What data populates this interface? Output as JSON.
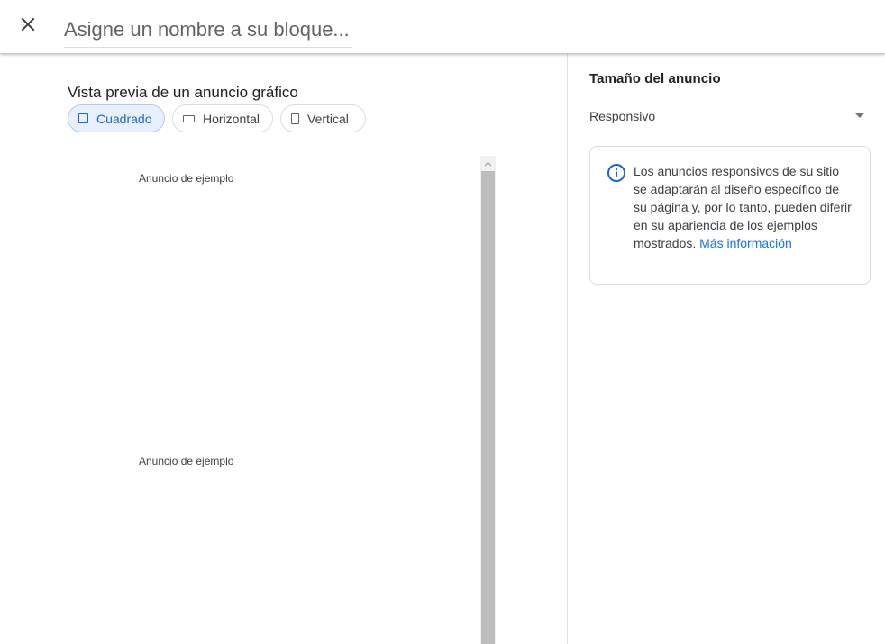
{
  "header": {
    "close_icon": "close-icon",
    "name_placeholder": "Asigne un nombre a su bloque..."
  },
  "preview": {
    "title": "Vista previa de un anuncio gráfico",
    "chips": [
      {
        "label": "Cuadrado",
        "icon": "square-icon",
        "selected": true
      },
      {
        "label": "Horizontal",
        "icon": "horizontal-rectangle-icon",
        "selected": false
      },
      {
        "label": "Vertical",
        "icon": "vertical-rectangle-icon",
        "selected": false
      }
    ],
    "sample_labels": [
      "Anuncio de ejemplo",
      "Anuncio de ejemplo"
    ]
  },
  "settings": {
    "size_heading": "Tamaño del anuncio",
    "size_value": "Responsivo",
    "info_text": "Los anuncios responsivos de su sitio se adaptarán al diseño específico de su página y, por lo tanto, pueden diferir en su apariencia de los ejemplos mostrados.",
    "info_link": "Más información",
    "info_icon": "info-icon"
  },
  "colors": {
    "accent": "#1967d2",
    "link": "#1a73e8",
    "chip_selected_bg": "#e8f0fe",
    "scrollbar_thumb": "#bdbdbd"
  }
}
